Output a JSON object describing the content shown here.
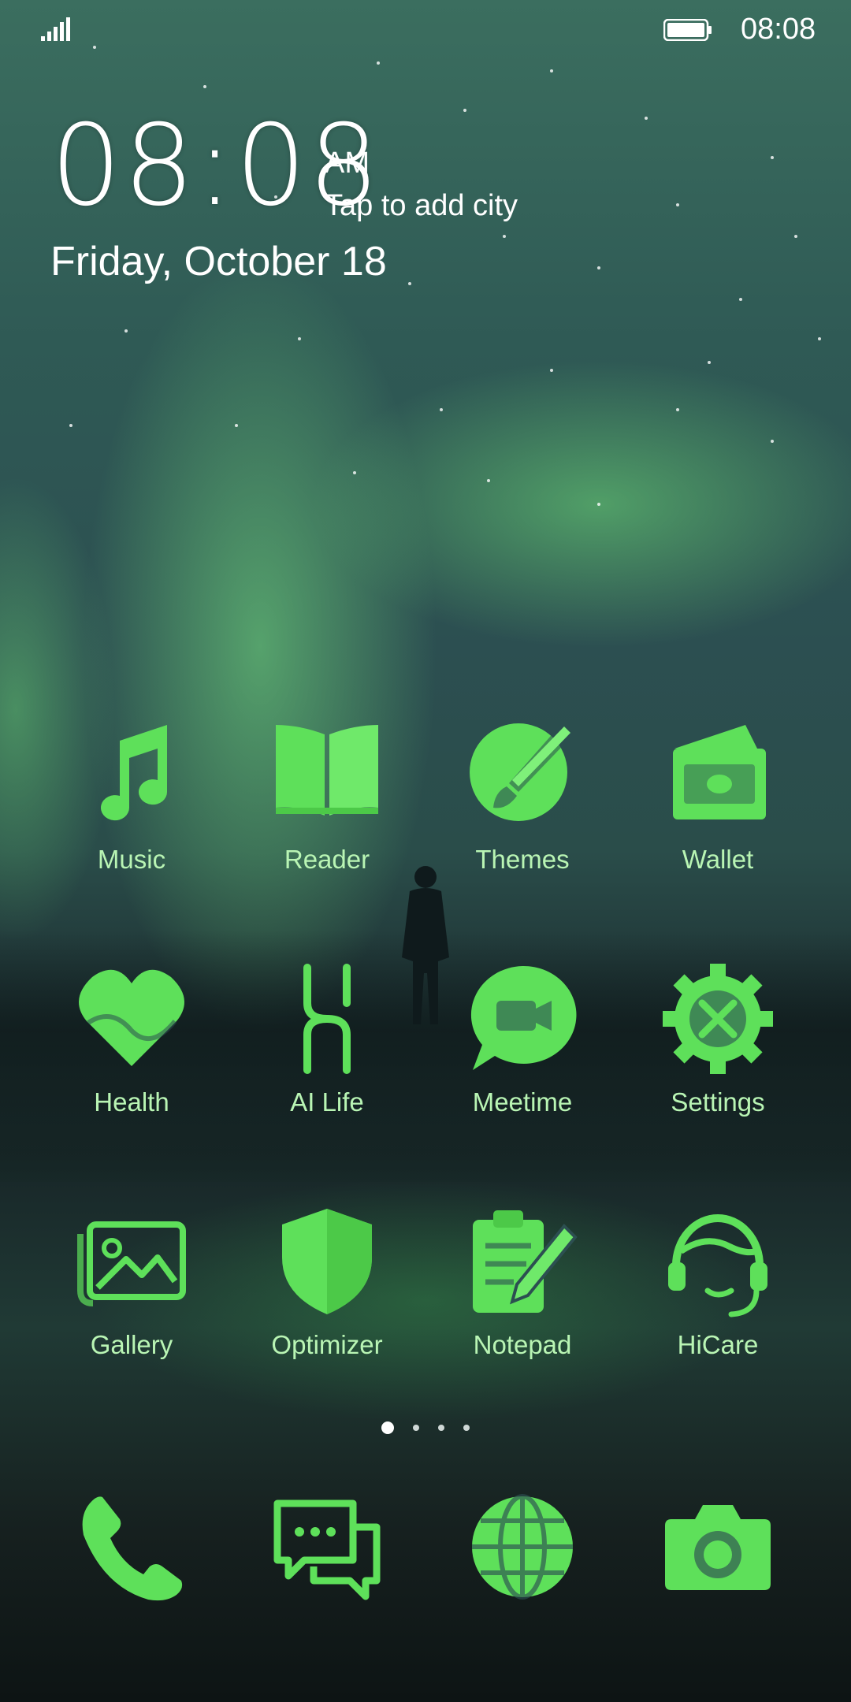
{
  "status_bar": {
    "time": "08:08"
  },
  "clock_widget": {
    "time": "08:08",
    "ampm": "AM",
    "city": "Tap to add city",
    "date": "Friday, October 18"
  },
  "apps": [
    {
      "label": "Music",
      "icon": "music-note-icon"
    },
    {
      "label": "Reader",
      "icon": "book-icon"
    },
    {
      "label": "Themes",
      "icon": "paintbrush-icon"
    },
    {
      "label": "Wallet",
      "icon": "wallet-icon"
    },
    {
      "label": "Health",
      "icon": "heart-icon"
    },
    {
      "label": "AI Life",
      "icon": "ai-life-icon"
    },
    {
      "label": "Meetime",
      "icon": "video-chat-icon"
    },
    {
      "label": "Settings",
      "icon": "gear-icon"
    },
    {
      "label": "Gallery",
      "icon": "picture-icon"
    },
    {
      "label": "Optimizer",
      "icon": "shield-icon"
    },
    {
      "label": "Notepad",
      "icon": "notepad-icon"
    },
    {
      "label": "HiCare",
      "icon": "headset-icon"
    }
  ],
  "dock": [
    {
      "icon": "phone-icon"
    },
    {
      "icon": "messages-icon"
    },
    {
      "icon": "globe-icon"
    },
    {
      "icon": "camera-icon"
    }
  ],
  "page_indicator": {
    "current": 1,
    "total": 4
  },
  "colors": {
    "icon_green": "#5ee05a",
    "label_green": "#b9f5b4"
  }
}
